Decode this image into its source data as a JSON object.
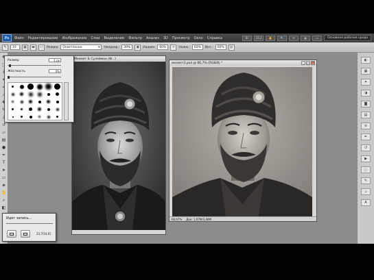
{
  "menubar": {
    "logo": "Ps",
    "items": [
      "Файл",
      "Редактирование",
      "Изображение",
      "Слои",
      "Выделение",
      "Фильтр",
      "Анализ",
      "3D",
      "Просмотр",
      "Окно",
      "Справка"
    ],
    "zoom": "33,3",
    "workspace_button": "Основная рабочая среда"
  },
  "options": {
    "brush_size": "10",
    "mode_label": "Режим:",
    "mode_value": "Осветление",
    "range_label": "Непрозр.:",
    "range_value": "39%",
    "pressure_label": "Нажим:",
    "pressure_value": "60%",
    "flow_label": "Нажм.:",
    "flow_value": "60%",
    "strength_label": "Инт.:",
    "strength_value": "60%"
  },
  "brush_panel": {
    "size_label": "Размер",
    "size_value": "1 px",
    "hardness_label": "Жёсткость",
    "hardness_value": "0%"
  },
  "doc1": {
    "title": "Мехмет & Сулейман (Ф...)",
    "status": "33,33%"
  },
  "doc2": {
    "title": "мехмет3.psd @ 66,7% (RGB/8) *",
    "status_zoom": "66,67%",
    "status_doc": "Док: 1,07М/3,46М"
  },
  "save_dialog": {
    "title": "Идет запись...",
    "value": "23,7/10,01"
  }
}
